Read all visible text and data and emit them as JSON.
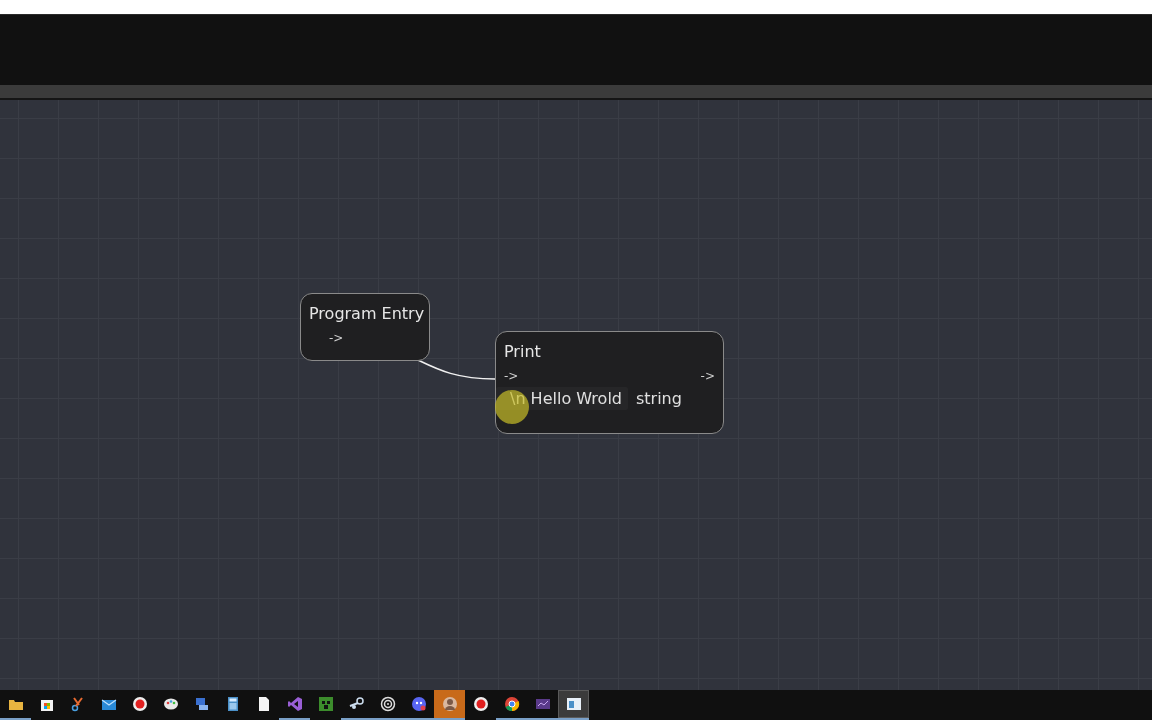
{
  "nodes": [
    {
      "kind": "entry",
      "title": "Program Entry",
      "exec_out": "->"
    },
    {
      "kind": "print",
      "title": "Print",
      "exec_in": "->",
      "exec_out": "->",
      "input_value": "\\n Hello Wrold",
      "input_type": "string"
    }
  ],
  "taskbar": [
    {
      "kind": "folder",
      "running": true,
      "attention": false,
      "selected": false
    },
    {
      "kind": "store",
      "running": false,
      "attention": false,
      "selected": false
    },
    {
      "kind": "snip",
      "running": false,
      "attention": false,
      "selected": false
    },
    {
      "kind": "mail",
      "running": false,
      "attention": false,
      "selected": false
    },
    {
      "kind": "record",
      "running": false,
      "attention": false,
      "selected": false
    },
    {
      "kind": "paint",
      "running": false,
      "attention": false,
      "selected": false
    },
    {
      "kind": "network",
      "running": false,
      "attention": false,
      "selected": false
    },
    {
      "kind": "calculator",
      "running": false,
      "attention": false,
      "selected": false
    },
    {
      "kind": "file",
      "running": false,
      "attention": false,
      "selected": false
    },
    {
      "kind": "studio",
      "running": true,
      "attention": false,
      "selected": false
    },
    {
      "kind": "game",
      "running": false,
      "attention": false,
      "selected": false
    },
    {
      "kind": "steam",
      "running": true,
      "attention": false,
      "selected": false
    },
    {
      "kind": "swirl",
      "running": true,
      "attention": false,
      "selected": false
    },
    {
      "kind": "chat",
      "running": true,
      "attention": false,
      "selected": false
    },
    {
      "kind": "avatar",
      "running": true,
      "attention": true,
      "selected": false
    },
    {
      "kind": "record",
      "running": false,
      "attention": false,
      "selected": false
    },
    {
      "kind": "browser",
      "running": true,
      "attention": false,
      "selected": false
    },
    {
      "kind": "media",
      "running": true,
      "attention": false,
      "selected": false
    },
    {
      "kind": "window",
      "running": true,
      "attention": false,
      "selected": true
    }
  ]
}
